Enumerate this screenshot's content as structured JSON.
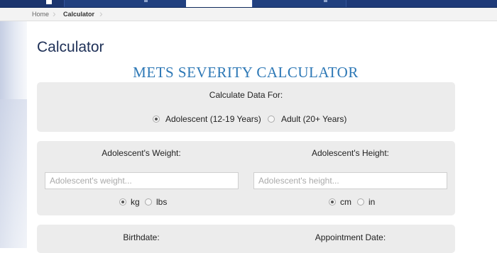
{
  "breadcrumb": {
    "home": "Home",
    "current": "Calculator"
  },
  "page_title": "Calculator",
  "calculator_title": "METS SEVERITY CALCULATOR",
  "calculate_for": {
    "label": "Calculate Data For:",
    "options": [
      {
        "label": "Adolescent (12-19 Years)",
        "checked": true
      },
      {
        "label": "Adult (20+ Years)",
        "checked": false
      }
    ]
  },
  "weight": {
    "label": "Adolescent's Weight:",
    "placeholder": "Adolescent's weight...",
    "units": [
      {
        "label": "kg",
        "checked": true
      },
      {
        "label": "lbs",
        "checked": false
      }
    ]
  },
  "height": {
    "label": "Adolescent's Height:",
    "placeholder": "Adolescent's height...",
    "units": [
      {
        "label": "cm",
        "checked": true
      },
      {
        "label": "in",
        "checked": false
      }
    ]
  },
  "dates": {
    "birthdate_label": "Birthdate:",
    "appointment_label": "Appointment Date:"
  },
  "colors": {
    "nav": "#1e3a78",
    "title_blue": "#2d78b6",
    "panel_bg": "#ececec",
    "heading": "#1e3057"
  }
}
